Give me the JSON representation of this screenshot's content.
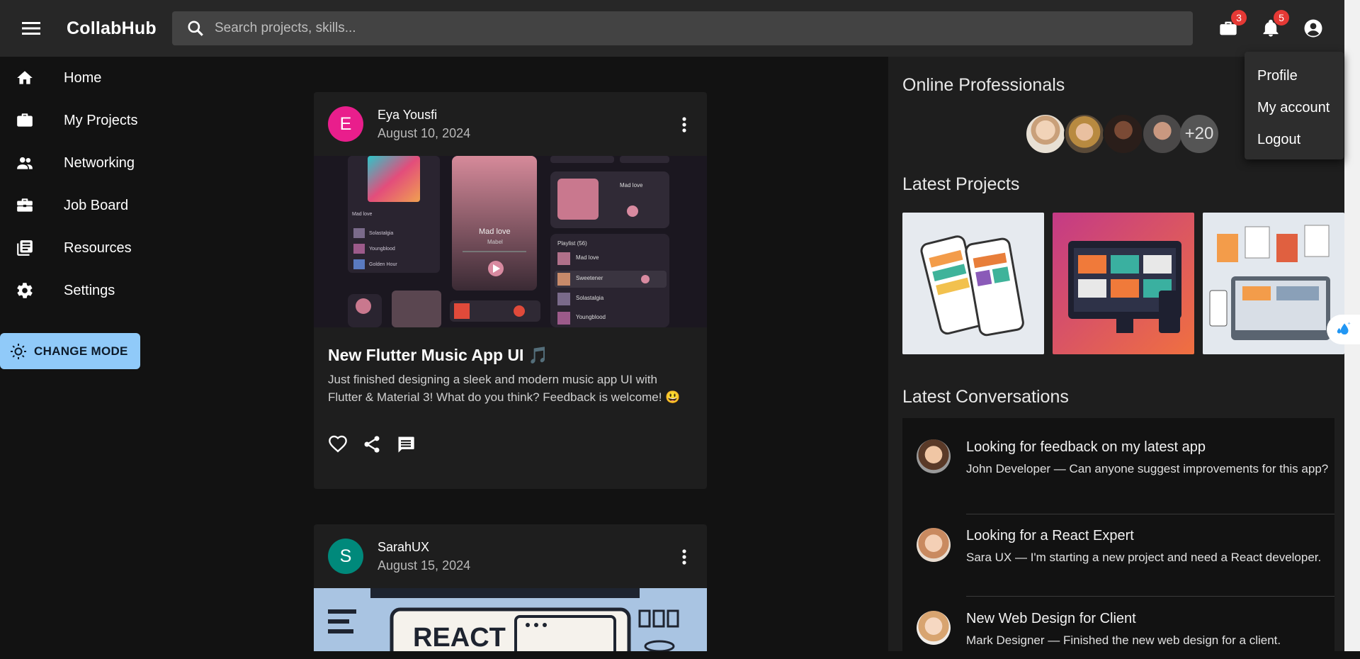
{
  "appbar": {
    "brand": "CollabHub",
    "search_placeholder": "Search projects, skills...",
    "briefcase_badge": "3",
    "notifications_badge": "5"
  },
  "sidebar": {
    "items": [
      {
        "label": "Home",
        "icon": "home-icon"
      },
      {
        "label": "My Projects",
        "icon": "briefcase-icon"
      },
      {
        "label": "Networking",
        "icon": "people-icon"
      },
      {
        "label": "Job Board",
        "icon": "toolbox-icon"
      },
      {
        "label": "Resources",
        "icon": "library-icon"
      },
      {
        "label": "Settings",
        "icon": "gear-icon"
      }
    ],
    "mode_button": "CHANGE MODE"
  },
  "feed": {
    "posts": [
      {
        "avatar_letter": "E",
        "avatar_color": "#e91e8c",
        "author": "Eya Yousfi",
        "date": "August 10, 2024",
        "title": "New Flutter Music App UI 🎵",
        "body": "Just finished designing a sleek and modern music app UI with Flutter & Material 3! What do you think? Feedback is welcome! 😃"
      },
      {
        "avatar_letter": "S",
        "avatar_color": "#00897b",
        "author": "SarahUX",
        "date": "August 15, 2024",
        "media_text": "REACT"
      }
    ],
    "music_mock": {
      "song": "Mad love",
      "artist": "Mabel",
      "playlist_label": "Playlist (56)",
      "tracks": [
        "Mad love",
        "Sweetener",
        "Solastalgia",
        "Youngblood"
      ],
      "left_tracks": [
        "Solastalgia",
        "Youngblood",
        "Golden Hour"
      ]
    }
  },
  "right_panel": {
    "online_title": "Online Professionals",
    "online_more": "+20",
    "projects_title": "Latest Projects",
    "conversations_title": "Latest Conversations",
    "conversations": [
      {
        "title": "Looking for feedback on my latest app",
        "subtitle": "John Developer — Can anyone suggest improvements for this app?"
      },
      {
        "title": "Looking for a React Expert",
        "subtitle": "Sara UX — I'm starting a new project and need a React developer."
      },
      {
        "title": "New Web Design for Client",
        "subtitle": "Mark Designer — Finished the new web design for a client."
      }
    ]
  },
  "account_menu": {
    "items": [
      "Profile",
      "My account",
      "Logout"
    ]
  },
  "colors": {
    "appbar": "#272727",
    "background": "#121212",
    "mode_button": "#90caf9",
    "badge": "#e53935"
  }
}
